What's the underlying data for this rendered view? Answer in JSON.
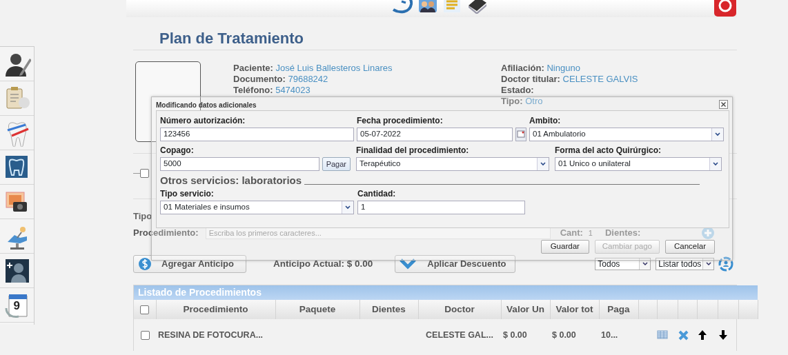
{
  "page_title": "Plan de Tratamiento",
  "sidebar": {
    "calendar_day": "9"
  },
  "patient": {
    "left": [
      {
        "label": "Paciente:",
        "value": "José Luis Ballesteros Linares"
      },
      {
        "label": "Documento:",
        "value": "79688242"
      },
      {
        "label": "Teléfono:",
        "value": "5474023"
      }
    ],
    "right": [
      {
        "label": "Afiliación:",
        "value": "Ninguno"
      },
      {
        "label": "Doctor titular:",
        "value": "CELESTE GALVIS"
      },
      {
        "label": "Estado:"
      },
      {
        "label": "Tipo:",
        "value": "Otro"
      }
    ]
  },
  "background_form": {
    "checkbox": {
      "checked": false
    },
    "tipo_label": "Tipo",
    "procedimiento_label": "Procedimiento:",
    "procedimiento_placeholder": "Escriba los primeros caracteres...",
    "cant_label": "Cant:",
    "cant_value": "1",
    "dientes_label": "Dientes:"
  },
  "dialog": {
    "title": "Modificando datos adicionales",
    "rows": [
      [
        {
          "kind": "text",
          "label": "Número autorización:",
          "value": "123456"
        },
        {
          "kind": "date",
          "label": "Fecha procedimiento:",
          "value": "05-07-2022"
        },
        {
          "kind": "select",
          "label": "Ambito:",
          "value": "01  Ambulatorio"
        }
      ],
      [
        {
          "kind": "pay",
          "label": "Copago:",
          "value": "5000",
          "button": "Pagar"
        },
        {
          "kind": "select",
          "label": "Finalidad del procedimiento:",
          "value": "Terapéutico"
        },
        {
          "kind": "select",
          "label": "Forma del acto Quirúrgico:",
          "value": "01  Unico o unilateral"
        }
      ]
    ],
    "section_title": "Otros servicios: laboratorios",
    "lab_fields": [
      {
        "kind": "select",
        "label": "Tipo servicio:",
        "value": "01 Materiales e insumos"
      },
      {
        "kind": "text",
        "label": "Cantidad:",
        "value": "1"
      }
    ],
    "buttons": [
      {
        "label": "Guardar",
        "disabled": false
      },
      {
        "label": "Cambiar pago",
        "disabled": true
      },
      {
        "label": "Cancelar",
        "disabled": false
      }
    ]
  },
  "toolbar": {
    "anticipo_button": "Agregar Anticipo",
    "anticipo_actual": "Anticipo Actual: $ 0.00",
    "descuento_button": "Aplicar Descuento",
    "filters": [
      "Todos",
      "Listar todos"
    ]
  },
  "table": {
    "title": "Listado de Procedimientos",
    "header_checkbox": {
      "checked": false
    },
    "columns": [
      "Procedimiento",
      "Paquete",
      "Dientes",
      "Doctor",
      "Valor Un",
      "Valor tot",
      "Paga"
    ],
    "rows": [
      {
        "checked": false,
        "procedimiento": "RESINA DE FOTOCURA...",
        "doctor": "CELESTE GAL...",
        "valor_un": "$ 0.00",
        "valor_tot": "$ 0.00",
        "paga": "10..."
      }
    ]
  }
}
